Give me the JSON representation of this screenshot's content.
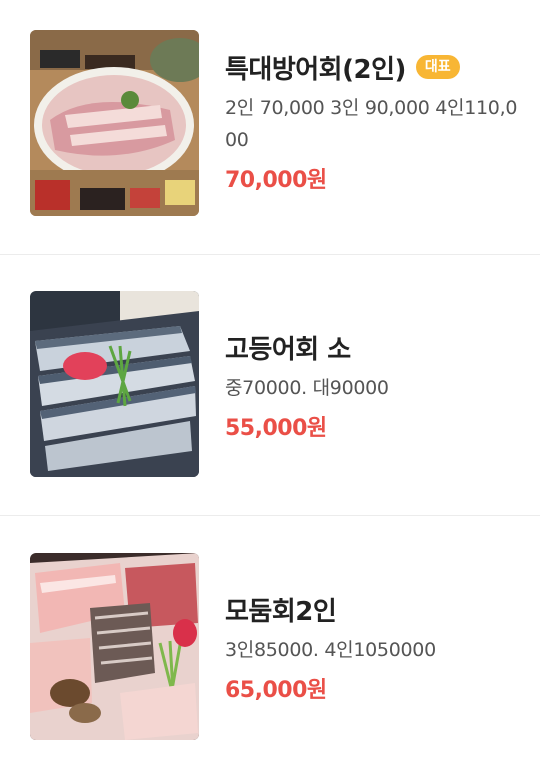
{
  "menu": {
    "items": [
      {
        "name": "특대방어회(2인)",
        "badge": "대표",
        "description": "2인 70,000 3인 90,000 4인110,000",
        "price": "70,000원",
        "image_icon": "yellowtail-sashimi-platter-photo"
      },
      {
        "name": "고등어회 소",
        "description": "중70000. 대90000",
        "price": "55,000원",
        "image_icon": "mackerel-sashimi-photo"
      },
      {
        "name": "모둠회2인",
        "description": "3인85000. 4인1050000",
        "price": "65,000원",
        "image_icon": "assorted-sashimi-photo"
      }
    ]
  },
  "colors": {
    "price": "#ea4f47",
    "badge_bg": "#f8b634",
    "title": "#222222",
    "description": "#555555",
    "divider": "#ececec"
  }
}
